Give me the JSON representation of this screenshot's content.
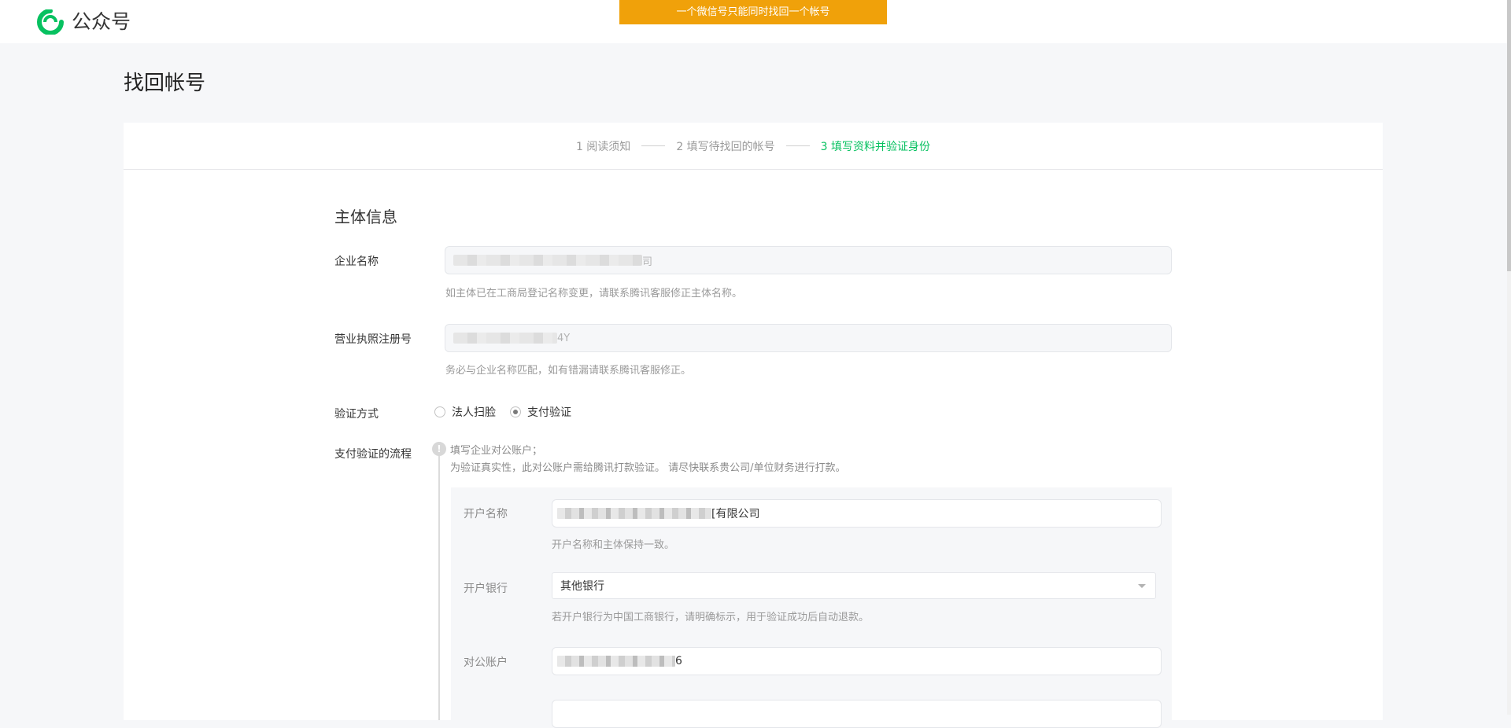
{
  "header": {
    "logo_text": "公众号",
    "banner": "一个微信号只能同时找回一个帐号"
  },
  "page": {
    "title": "找回帐号"
  },
  "steps": [
    {
      "label": "1 阅读须知",
      "active": false
    },
    {
      "label": "2 填写待找回的帐号",
      "active": false
    },
    {
      "label": "3 填写资料并验证身份",
      "active": true
    }
  ],
  "section": {
    "title": "主体信息"
  },
  "form": {
    "company_name": {
      "label": "企业名称",
      "value_suffix": "司",
      "hint": "如主体已在工商局登记名称变更，请联系腾讯客服修正主体名称。"
    },
    "license_no": {
      "label": "营业执照注册号",
      "value_suffix": "4Y",
      "hint": "务必与企业名称匹配，如有错漏请联系腾讯客服修正。"
    },
    "verify_method": {
      "label": "验证方式",
      "options": [
        {
          "label": "法人扫脸",
          "checked": false
        },
        {
          "label": "支付验证",
          "checked": true
        }
      ]
    },
    "payment_flow": {
      "label": "支付验证的流程",
      "step_icon": "!",
      "line1": "填写企业对公账户；",
      "line2": "为验证真实性，此对公账户需给腾讯打款验证。 请尽快联系贵公司/单位财务进行打款。"
    },
    "account_name": {
      "label": "开户名称",
      "value_suffix": "[有限公司",
      "hint": "开户名称和主体保持一致。"
    },
    "bank": {
      "label": "开户银行",
      "value": "其他银行",
      "hint": "若开户银行为中国工商银行，请明确标示，用于验证成功后自动退款。"
    },
    "account_no": {
      "label": "对公账户",
      "value_suffix": "6"
    }
  },
  "colors": {
    "accent": "#07c160",
    "banner": "#f0a10a"
  }
}
